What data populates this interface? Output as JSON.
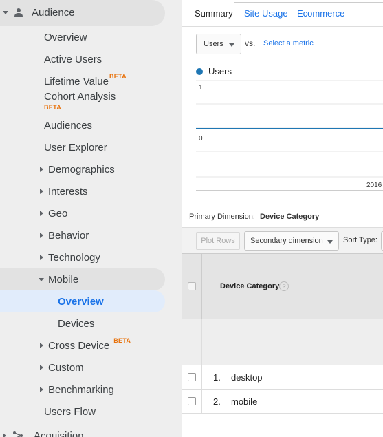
{
  "sidebar": {
    "section_label": "Audience",
    "items": [
      {
        "label": "Overview"
      },
      {
        "label": "Active Users"
      },
      {
        "label": "Lifetime Value",
        "beta": "BETA"
      },
      {
        "label": "Cohort Analysis",
        "beta": "BETA"
      },
      {
        "label": "Audiences"
      },
      {
        "label": "User Explorer"
      },
      {
        "label": "Demographics"
      },
      {
        "label": "Interests"
      },
      {
        "label": "Geo"
      },
      {
        "label": "Behavior"
      },
      {
        "label": "Technology"
      },
      {
        "label": "Mobile"
      },
      {
        "label": "Overview"
      },
      {
        "label": "Devices"
      },
      {
        "label": "Cross Device",
        "beta": "BETA"
      },
      {
        "label": "Custom"
      },
      {
        "label": "Benchmarking"
      },
      {
        "label": "Users Flow"
      }
    ],
    "next_section_label": "Acquisition"
  },
  "tabs": {
    "summary": "Summary",
    "site_usage": "Site Usage",
    "ecommerce": "Ecommerce"
  },
  "metric": {
    "selected": "Users",
    "vs_label": "vs.",
    "select_metric": "Select a metric"
  },
  "chart_data": {
    "type": "line",
    "series": [
      {
        "name": "Users",
        "values": [
          0,
          0
        ]
      }
    ],
    "x": [
      "",
      "2016"
    ],
    "ylim": [
      0,
      1
    ],
    "y_ticks": [
      "1",
      "0"
    ],
    "x_tick_label": "2016",
    "color": "#1f77b4",
    "grid": true,
    "legend": "top-left"
  },
  "primary_dimension": {
    "label": "Primary Dimension:",
    "value": "Device Category"
  },
  "toolbar": {
    "plot_rows": "Plot Rows",
    "secondary_dimension": "Secondary dimension",
    "sort_type": "Sort Type:"
  },
  "table": {
    "header": "Device Category",
    "help": "?",
    "rows": [
      {
        "index": "1.",
        "value": "desktop"
      },
      {
        "index": "2.",
        "value": "mobile"
      }
    ]
  }
}
